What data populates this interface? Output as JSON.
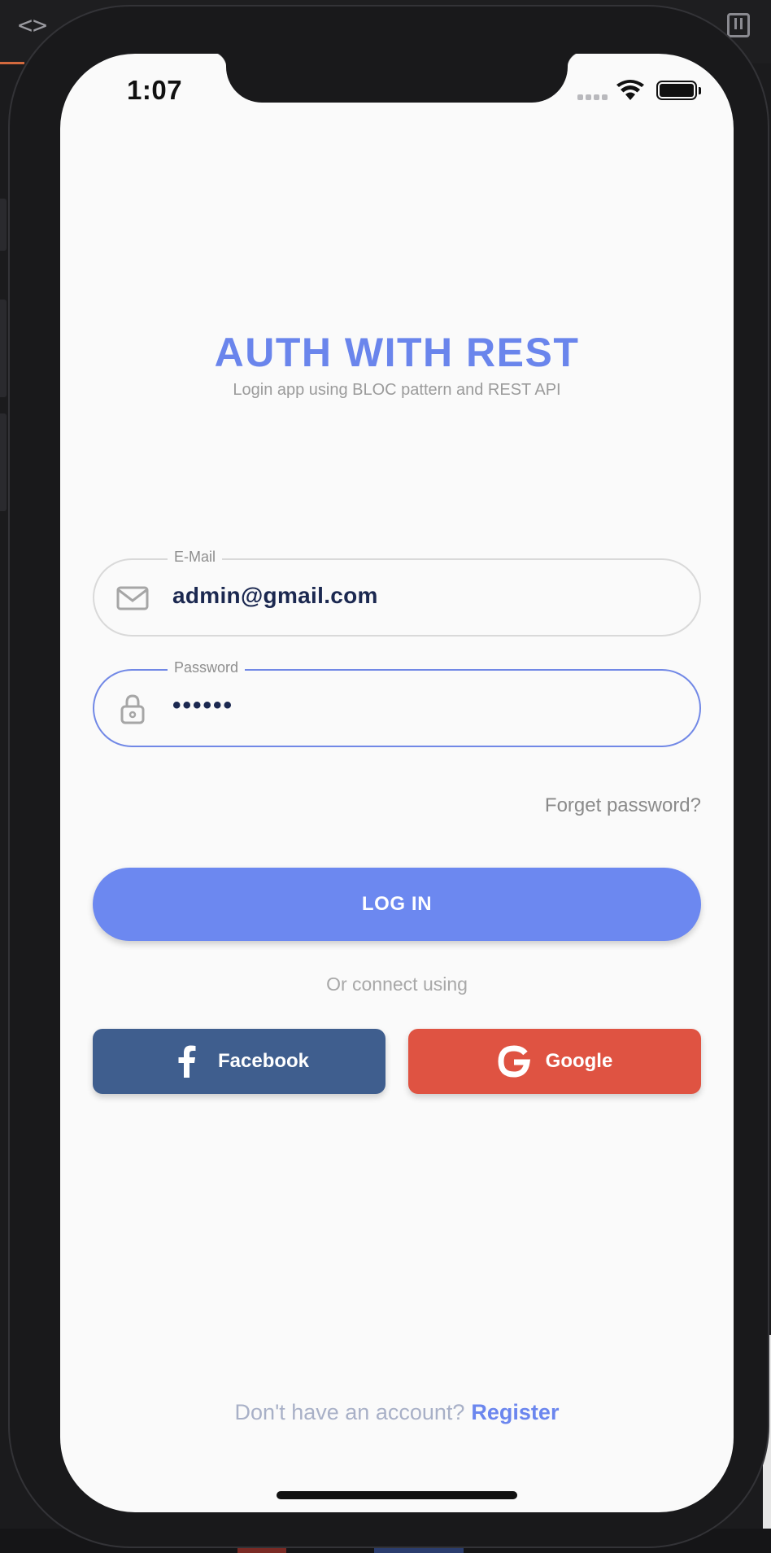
{
  "status_bar": {
    "time": "1:07"
  },
  "header": {
    "title": "AUTH WITH REST",
    "subtitle": "Login app using BLOC pattern and REST API"
  },
  "form": {
    "email": {
      "label": "E-Mail",
      "value": "admin@gmail.com",
      "icon": "mail-icon"
    },
    "password": {
      "label": "Password",
      "value": "••••••",
      "icon": "lock-icon"
    },
    "forgot_label": "Forget password?",
    "login_label": "LOG IN"
  },
  "social": {
    "divider_text": "Or connect using",
    "facebook_label": "Facebook",
    "google_label": "Google"
  },
  "footer": {
    "prompt": "Don't have an account?",
    "register_label": "Register"
  },
  "colors": {
    "accent": "#6c88f0",
    "facebook": "#3f5e8e",
    "google": "#df5342",
    "input_text": "#1b2850"
  }
}
